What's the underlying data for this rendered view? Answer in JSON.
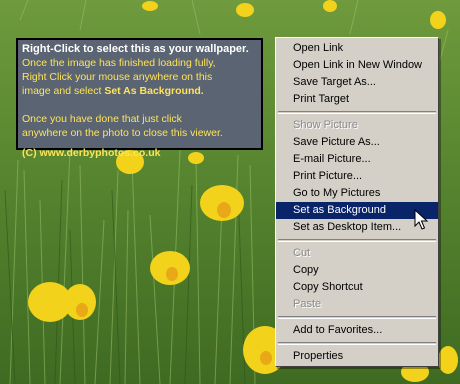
{
  "info_box": {
    "headline": "Right-Click to select this as your wallpaper.",
    "line1": "Once the image has finished loading fully,",
    "line2": "Right Click your mouse anywhere on this",
    "line3_prefix": "image and select ",
    "line3_bold": "Set As Background.",
    "line4": "Once you have done that just click",
    "line5": "anywhere on the photo to close this viewer.",
    "copyright": "(C) www.derbyphotos.co.uk"
  },
  "context_menu": {
    "open_link": "Open Link",
    "open_link_new_window": "Open Link in New Window",
    "save_target_as": "Save Target As...",
    "print_target": "Print Target",
    "show_picture": "Show Picture",
    "save_picture_as": "Save Picture As...",
    "email_picture": "E-mail Picture...",
    "print_picture": "Print Picture...",
    "go_to_my_pictures": "Go to My Pictures",
    "set_as_background": "Set as Background",
    "set_as_desktop_item": "Set as Desktop Item...",
    "cut": "Cut",
    "copy": "Copy",
    "copy_shortcut": "Copy Shortcut",
    "paste": "Paste",
    "add_to_favorites": "Add to Favorites...",
    "properties": "Properties"
  },
  "colors": {
    "info_text": "#ffe35a",
    "info_bg": "#5a6472",
    "menu_bg": "#d4d0c8",
    "highlight": "#0a246a"
  }
}
